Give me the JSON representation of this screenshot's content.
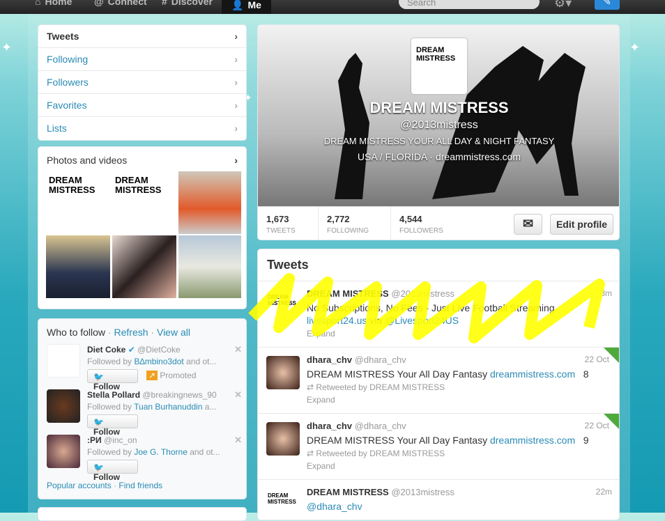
{
  "topbar": {
    "nav": [
      "Home",
      "Connect",
      "Discover",
      "Me"
    ],
    "search_placeholder": "Search"
  },
  "sidebar": {
    "items": [
      {
        "label": "Tweets"
      },
      {
        "label": "Following"
      },
      {
        "label": "Followers"
      },
      {
        "label": "Favorites"
      },
      {
        "label": "Lists"
      }
    ]
  },
  "photos": {
    "title": "Photos and videos",
    "logo_text": "DREAM MISTRESS"
  },
  "who_to_follow": {
    "title": "Who to follow",
    "refresh": "Refresh",
    "view_all": "View all",
    "suggestions": [
      {
        "name": "Diet Coke",
        "handle": "@DietCoke",
        "followed_prefix": "Followed by ",
        "followed_by": "B∆mbino3dot",
        "followed_suffix": " and ot...",
        "promoted": "Promoted",
        "verified": true
      },
      {
        "name": "Stella Pollard",
        "handle": "@breakingnews_90",
        "followed_prefix": "Followed by ",
        "followed_by": "Tuan Burhanuddin",
        "followed_suffix": " a..."
      },
      {
        "name": ":PИ",
        "handle": "@inc_on",
        "followed_prefix": "Followed by ",
        "followed_by": "Joe G. Thorne",
        "followed_suffix": " and ot..."
      }
    ],
    "follow_label": "Follow",
    "popular": "Popular accounts",
    "find_friends": "Find friends"
  },
  "profile": {
    "avatar_text": "DREAM MISTRESS",
    "name": "DREAM MISTRESS",
    "handle": "@2013mistress",
    "bio": "DREAM MISTRESS YOUR ALL DAY & NIGHT FANTASY",
    "location": "USA / FLORIDA",
    "url": "dreammistress.com",
    "stats": [
      {
        "value": "1,673",
        "label": "TWEETS"
      },
      {
        "value": "2,772",
        "label": "FOLLOWING"
      },
      {
        "value": "4,544",
        "label": "FOLLOWERS"
      }
    ],
    "edit_label": "Edit profile"
  },
  "tweets": {
    "title": "Tweets",
    "items": [
      {
        "name": "DREAM MISTRESS",
        "handle": "@2013mistress",
        "time": "3m",
        "text": "No Subscriptions, No Fees - Just Live Football Streaming",
        "link1": "livesport24.us",
        "via": " via ",
        "link2": "@Livesport24US",
        "expand": "Expand"
      },
      {
        "name": "dhara_chv",
        "handle": "@dhara_chv",
        "time": "22 Oct",
        "text": "DREAM MISTRESS Your All Day Fantasy ",
        "link1": "dreammistress.com",
        "count": "8",
        "retweeted": "Retweeted by DREAM MISTRESS",
        "expand": "Expand"
      },
      {
        "name": "dhara_chv",
        "handle": "@dhara_chv",
        "time": "22 Oct",
        "text": "DREAM MISTRESS Your All Day Fantasy ",
        "link1": "dreammistress.com",
        "count": "9",
        "retweeted": "Retweeted by DREAM MISTRESS",
        "expand": "Expand"
      },
      {
        "name": "DREAM MISTRESS",
        "handle": "@2013mistress",
        "time": "22m",
        "link1": "@dhara_chv"
      }
    ]
  },
  "colors": {
    "link": "#2a8bb5",
    "highlight": "#ffff00"
  }
}
